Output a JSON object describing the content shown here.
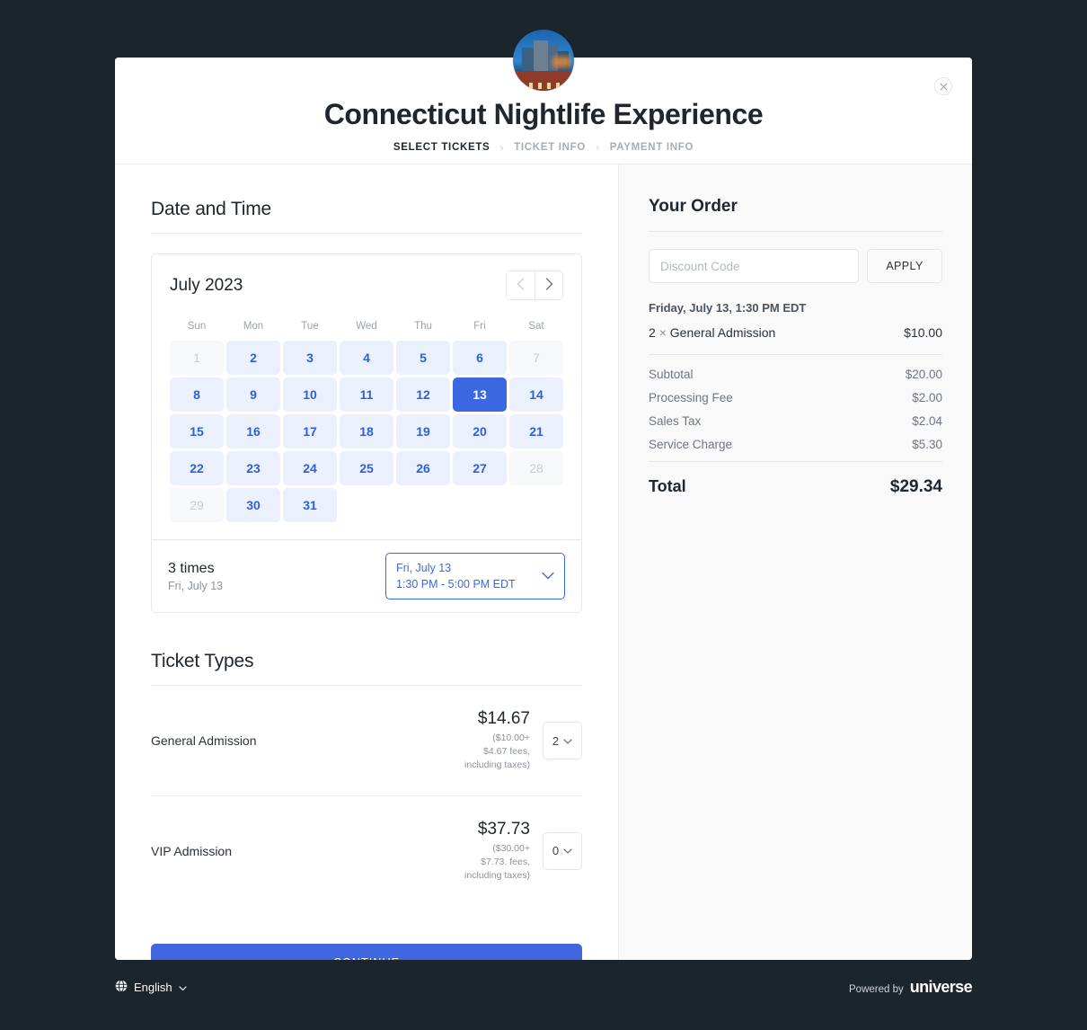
{
  "header": {
    "title": "Connecticut Nightlife Experience",
    "close_icon": "close-icon",
    "avatar_icon": "event-avatar-image",
    "steps": [
      {
        "label": "SELECT TICKETS",
        "active": true
      },
      {
        "label": "TICKET INFO",
        "active": false
      },
      {
        "label": "PAYMENT INFO",
        "active": false
      }
    ],
    "separator": "›"
  },
  "left": {
    "date_time_heading": "Date and Time",
    "calendar": {
      "month_label": "July 2023",
      "prev_icon": "chevron-left-icon",
      "next_icon": "chevron-right-icon",
      "day_names": [
        "Sun",
        "Mon",
        "Tue",
        "Wed",
        "Thu",
        "Fri",
        "Sat"
      ],
      "weeks": [
        [
          {
            "d": "1",
            "s": "disabled"
          },
          {
            "d": "2",
            "s": "available"
          },
          {
            "d": "3",
            "s": "available"
          },
          {
            "d": "4",
            "s": "available"
          },
          {
            "d": "5",
            "s": "available"
          },
          {
            "d": "6",
            "s": "available"
          },
          {
            "d": "7",
            "s": "disabled"
          }
        ],
        [
          {
            "d": "8",
            "s": "available"
          },
          {
            "d": "9",
            "s": "available"
          },
          {
            "d": "10",
            "s": "available"
          },
          {
            "d": "11",
            "s": "available"
          },
          {
            "d": "12",
            "s": "available"
          },
          {
            "d": "13",
            "s": "selected"
          },
          {
            "d": "14",
            "s": "available"
          }
        ],
        [
          {
            "d": "15",
            "s": "available"
          },
          {
            "d": "16",
            "s": "available"
          },
          {
            "d": "17",
            "s": "available"
          },
          {
            "d": "18",
            "s": "available"
          },
          {
            "d": "19",
            "s": "available"
          },
          {
            "d": "20",
            "s": "available"
          },
          {
            "d": "21",
            "s": "available"
          }
        ],
        [
          {
            "d": "22",
            "s": "available"
          },
          {
            "d": "23",
            "s": "available"
          },
          {
            "d": "24",
            "s": "available"
          },
          {
            "d": "25",
            "s": "available"
          },
          {
            "d": "26",
            "s": "available"
          },
          {
            "d": "27",
            "s": "available"
          },
          {
            "d": "28",
            "s": "disabled"
          }
        ],
        [
          {
            "d": "29",
            "s": "disabled"
          },
          {
            "d": "30",
            "s": "available"
          },
          {
            "d": "31",
            "s": "available"
          },
          {
            "d": "",
            "s": "empty"
          },
          {
            "d": "",
            "s": "empty"
          },
          {
            "d": "",
            "s": "empty"
          },
          {
            "d": "",
            "s": "empty"
          }
        ]
      ]
    },
    "times": {
      "count_label": "3 times",
      "date_label": "Fri, July 13",
      "selected_date": "Fri, July 13",
      "selected_time": "1:30 PM - 5:00 PM EDT",
      "chevron_icon": "chevron-down-icon"
    },
    "ticket_types_heading": "Ticket Types",
    "tickets": [
      {
        "name": "General Admission",
        "price": "$14.67",
        "fine_line1": "($10.00+",
        "fine_line2": "$4.67 fees,",
        "fine_line3": "including taxes)",
        "quantity": "2"
      },
      {
        "name": "VIP Admission",
        "price": "$37.73",
        "fine_line1": "($30.00+",
        "fine_line2": "$7.73. fees,",
        "fine_line3": "including taxes)",
        "quantity": "0"
      }
    ],
    "continue_label": "CONTINUE"
  },
  "order": {
    "title": "Your Order",
    "discount_placeholder": "Discount Code",
    "discount_value": "",
    "apply_label": "APPLY",
    "when": "Friday, July 13, 1:30 PM EDT",
    "item_qty": "2",
    "item_mult": "×",
    "item_name": "General Admission",
    "item_price": "$10.00",
    "lines": [
      {
        "label": "Subtotal",
        "value": "$20.00"
      },
      {
        "label": "Processing Fee",
        "value": "$2.00"
      },
      {
        "label": "Sales Tax",
        "value": "$2.04"
      },
      {
        "label": "Service Charge",
        "value": "$5.30"
      }
    ],
    "total_label": "Total",
    "total_value": "$29.34"
  },
  "footer": {
    "globe_icon": "globe-icon",
    "language": "English",
    "language_chevron_icon": "chevron-down-icon",
    "powered_by": "Powered by",
    "brand": "universe"
  },
  "colors": {
    "page_bg": "#1c242c",
    "accent_blue": "#4066e0",
    "calendar_day_bg": "#eaf1fd",
    "calendar_selected": "#3b68e0",
    "panel_bg": "#f9f9fa"
  }
}
